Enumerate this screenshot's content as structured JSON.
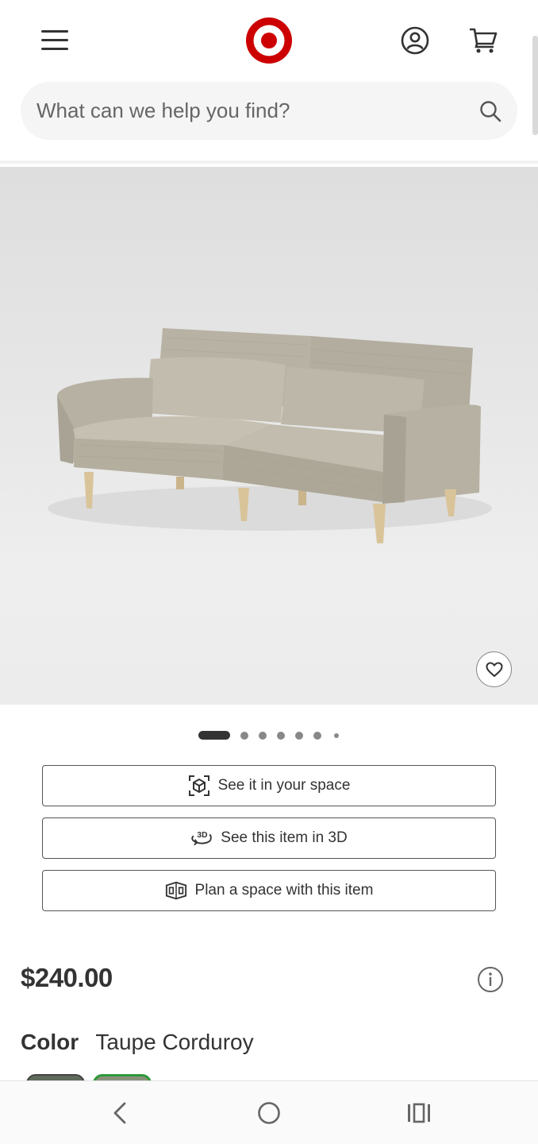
{
  "header": {
    "menu_icon": "hamburger-menu-icon",
    "logo_icon": "target-bullseye-logo",
    "account_icon": "account-circle-icon",
    "cart_icon": "cart-icon"
  },
  "search": {
    "placeholder": "What can we help you find?",
    "value": "",
    "icon": "search-icon"
  },
  "product": {
    "image_alt": "Taupe corduroy futon sofa",
    "favorite_icon": "heart-icon",
    "carousel": {
      "total": 7,
      "active_index": 0
    },
    "actions": [
      {
        "label": "See it in your space",
        "icon": "ar-cube-icon"
      },
      {
        "label": "See this item in 3D",
        "icon": "rotate-3d-icon"
      },
      {
        "label": "Plan a space with this item",
        "icon": "room-planner-icon"
      }
    ],
    "price": "$240.00",
    "info_icon": "info-icon",
    "color_label": "Color",
    "color_value": "Taupe Corduroy"
  },
  "system_nav": {
    "back_icon": "back-chevron-icon",
    "home_icon": "home-circle-icon",
    "recent_icon": "recent-apps-icon"
  },
  "colors": {
    "brand_red": "#cc0000",
    "text": "#333333",
    "swatch_selected_border": "#2e9a3a"
  }
}
